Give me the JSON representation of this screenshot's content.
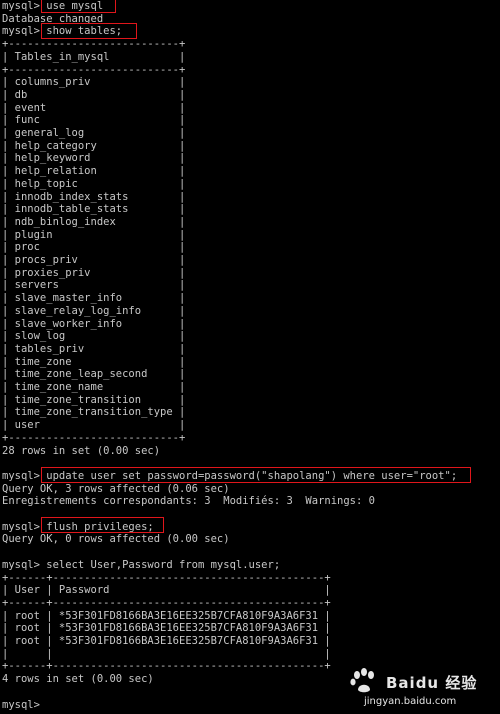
{
  "terminal": {
    "lines": [
      "mysql> use mysql",
      "Database changed",
      "mysql> show tables;",
      "+---------------------------+",
      "| Tables_in_mysql           |",
      "+---------------------------+",
      "| columns_priv              |",
      "| db                        |",
      "| event                     |",
      "| func                      |",
      "| general_log               |",
      "| help_category             |",
      "| help_keyword              |",
      "| help_relation             |",
      "| help_topic                |",
      "| innodb_index_stats        |",
      "| innodb_table_stats        |",
      "| ndb_binlog_index          |",
      "| plugin                    |",
      "| proc                      |",
      "| procs_priv                |",
      "| proxies_priv              |",
      "| servers                   |",
      "| slave_master_info         |",
      "| slave_relay_log_info      |",
      "| slave_worker_info         |",
      "| slow_log                  |",
      "| tables_priv               |",
      "| time_zone                 |",
      "| time_zone_leap_second     |",
      "| time_zone_name            |",
      "| time_zone_transition      |",
      "| time_zone_transition_type |",
      "| user                      |",
      "+---------------------------+",
      "28 rows in set (0.00 sec)",
      "",
      "mysql> update user set password=password(\"shapolang\") where user=\"root\";",
      "Query OK, 3 rows affected (0.06 sec)",
      "Enregistrements correspondants: 3  Modifiés: 3  Warnings: 0",
      "",
      "mysql> flush privileges;",
      "Query OK, 0 rows affected (0.00 sec)",
      "",
      "mysql> select User,Password from mysql.user;",
      "+------+-------------------------------------------+",
      "| User | Password                                  |",
      "+------+-------------------------------------------+",
      "| root | *53F301FD8166BA3E16EE325B7CFA810F9A3A6F31 |",
      "| root | *53F301FD8166BA3E16EE325B7CFA810F9A3A6F31 |",
      "| root | *53F301FD8166BA3E16EE325B7CFA810F9A3A6F31 |",
      "|      |                                           |",
      "+------+-------------------------------------------+",
      "4 rows in set (0.00 sec)",
      "",
      "mysql>"
    ]
  },
  "watermark": {
    "brand": "Baidu 经验",
    "url": "jingyan.baidu.com"
  }
}
